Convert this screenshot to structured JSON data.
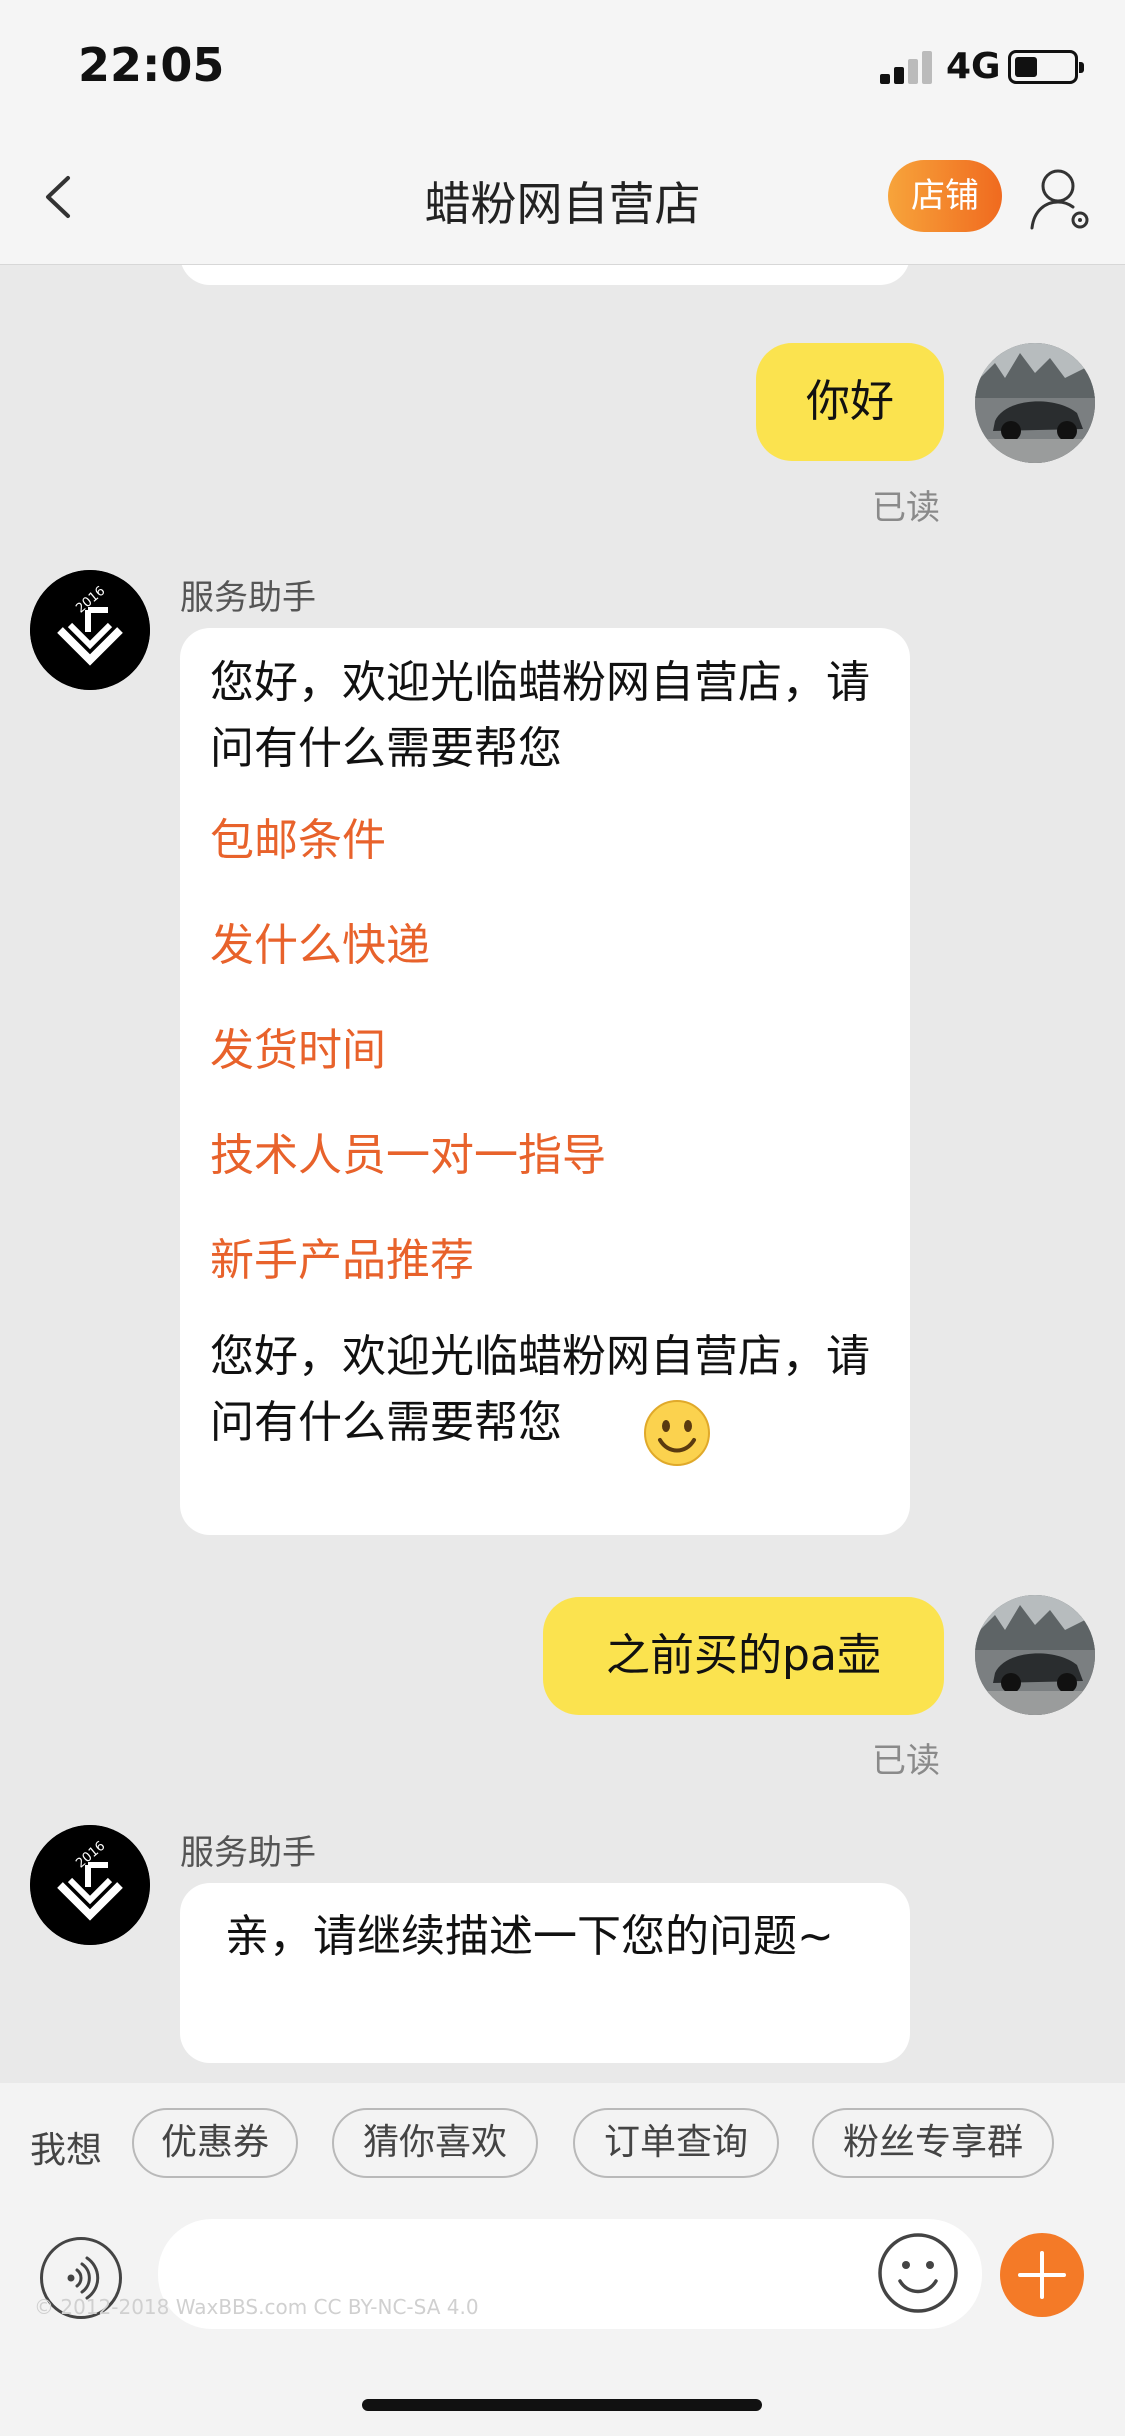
{
  "status_bar": {
    "time": "22:05",
    "network": "4G",
    "battery_level": 0.35
  },
  "nav": {
    "title": "蜡粉网自营店",
    "shop_button": "店铺"
  },
  "messages": {
    "m1": {
      "text": "你好",
      "status": "已读"
    },
    "m2": {
      "sender": "服务助手",
      "intro": "您好，欢迎光临蜡粉网自营店，请问有什么需要帮您",
      "links": [
        "包邮条件",
        "发什么快递",
        "发货时间",
        "技术人员一对一指导",
        "新手产品推荐"
      ],
      "outro": "您好，欢迎光临蜡粉网自营店，请问有什么需要帮您"
    },
    "m3": {
      "text": "之前买的pa壶",
      "status": "已读"
    },
    "m4": {
      "sender": "服务助手",
      "text": "亲，请继续描述一下您的问题~"
    }
  },
  "quick_bar": {
    "label": "我想",
    "chips": [
      "优惠券",
      "猜你喜欢",
      "订单查询",
      "粉丝专享群"
    ]
  },
  "input_bar": {
    "input_value": "",
    "watermark": "© 2012-2018 WaxBBS.com CC BY-NC-SA 4.0"
  },
  "colors": {
    "accent": "#f47a27",
    "link": "#e8622b",
    "user_bubble": "#fbe34f"
  },
  "icons": {
    "back": "chevron-left-icon",
    "user_settings": "user-gear-icon",
    "voice": "voice-icon",
    "emoji": "smiley-icon",
    "plus": "plus-icon"
  }
}
